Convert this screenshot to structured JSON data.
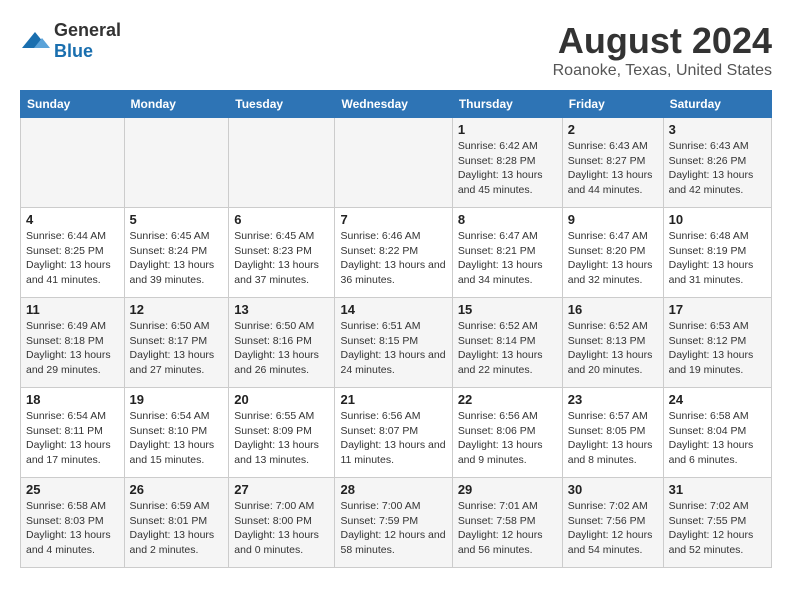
{
  "logo": {
    "text_general": "General",
    "text_blue": "Blue"
  },
  "title": "August 2024",
  "subtitle": "Roanoke, Texas, United States",
  "headers": [
    "Sunday",
    "Monday",
    "Tuesday",
    "Wednesday",
    "Thursday",
    "Friday",
    "Saturday"
  ],
  "weeks": [
    [
      {
        "day": "",
        "sunrise": "",
        "sunset": "",
        "daylight": ""
      },
      {
        "day": "",
        "sunrise": "",
        "sunset": "",
        "daylight": ""
      },
      {
        "day": "",
        "sunrise": "",
        "sunset": "",
        "daylight": ""
      },
      {
        "day": "",
        "sunrise": "",
        "sunset": "",
        "daylight": ""
      },
      {
        "day": "1",
        "sunrise": "Sunrise: 6:42 AM",
        "sunset": "Sunset: 8:28 PM",
        "daylight": "Daylight: 13 hours and 45 minutes."
      },
      {
        "day": "2",
        "sunrise": "Sunrise: 6:43 AM",
        "sunset": "Sunset: 8:27 PM",
        "daylight": "Daylight: 13 hours and 44 minutes."
      },
      {
        "day": "3",
        "sunrise": "Sunrise: 6:43 AM",
        "sunset": "Sunset: 8:26 PM",
        "daylight": "Daylight: 13 hours and 42 minutes."
      }
    ],
    [
      {
        "day": "4",
        "sunrise": "Sunrise: 6:44 AM",
        "sunset": "Sunset: 8:25 PM",
        "daylight": "Daylight: 13 hours and 41 minutes."
      },
      {
        "day": "5",
        "sunrise": "Sunrise: 6:45 AM",
        "sunset": "Sunset: 8:24 PM",
        "daylight": "Daylight: 13 hours and 39 minutes."
      },
      {
        "day": "6",
        "sunrise": "Sunrise: 6:45 AM",
        "sunset": "Sunset: 8:23 PM",
        "daylight": "Daylight: 13 hours and 37 minutes."
      },
      {
        "day": "7",
        "sunrise": "Sunrise: 6:46 AM",
        "sunset": "Sunset: 8:22 PM",
        "daylight": "Daylight: 13 hours and 36 minutes."
      },
      {
        "day": "8",
        "sunrise": "Sunrise: 6:47 AM",
        "sunset": "Sunset: 8:21 PM",
        "daylight": "Daylight: 13 hours and 34 minutes."
      },
      {
        "day": "9",
        "sunrise": "Sunrise: 6:47 AM",
        "sunset": "Sunset: 8:20 PM",
        "daylight": "Daylight: 13 hours and 32 minutes."
      },
      {
        "day": "10",
        "sunrise": "Sunrise: 6:48 AM",
        "sunset": "Sunset: 8:19 PM",
        "daylight": "Daylight: 13 hours and 31 minutes."
      }
    ],
    [
      {
        "day": "11",
        "sunrise": "Sunrise: 6:49 AM",
        "sunset": "Sunset: 8:18 PM",
        "daylight": "Daylight: 13 hours and 29 minutes."
      },
      {
        "day": "12",
        "sunrise": "Sunrise: 6:50 AM",
        "sunset": "Sunset: 8:17 PM",
        "daylight": "Daylight: 13 hours and 27 minutes."
      },
      {
        "day": "13",
        "sunrise": "Sunrise: 6:50 AM",
        "sunset": "Sunset: 8:16 PM",
        "daylight": "Daylight: 13 hours and 26 minutes."
      },
      {
        "day": "14",
        "sunrise": "Sunrise: 6:51 AM",
        "sunset": "Sunset: 8:15 PM",
        "daylight": "Daylight: 13 hours and 24 minutes."
      },
      {
        "day": "15",
        "sunrise": "Sunrise: 6:52 AM",
        "sunset": "Sunset: 8:14 PM",
        "daylight": "Daylight: 13 hours and 22 minutes."
      },
      {
        "day": "16",
        "sunrise": "Sunrise: 6:52 AM",
        "sunset": "Sunset: 8:13 PM",
        "daylight": "Daylight: 13 hours and 20 minutes."
      },
      {
        "day": "17",
        "sunrise": "Sunrise: 6:53 AM",
        "sunset": "Sunset: 8:12 PM",
        "daylight": "Daylight: 13 hours and 19 minutes."
      }
    ],
    [
      {
        "day": "18",
        "sunrise": "Sunrise: 6:54 AM",
        "sunset": "Sunset: 8:11 PM",
        "daylight": "Daylight: 13 hours and 17 minutes."
      },
      {
        "day": "19",
        "sunrise": "Sunrise: 6:54 AM",
        "sunset": "Sunset: 8:10 PM",
        "daylight": "Daylight: 13 hours and 15 minutes."
      },
      {
        "day": "20",
        "sunrise": "Sunrise: 6:55 AM",
        "sunset": "Sunset: 8:09 PM",
        "daylight": "Daylight: 13 hours and 13 minutes."
      },
      {
        "day": "21",
        "sunrise": "Sunrise: 6:56 AM",
        "sunset": "Sunset: 8:07 PM",
        "daylight": "Daylight: 13 hours and 11 minutes."
      },
      {
        "day": "22",
        "sunrise": "Sunrise: 6:56 AM",
        "sunset": "Sunset: 8:06 PM",
        "daylight": "Daylight: 13 hours and 9 minutes."
      },
      {
        "day": "23",
        "sunrise": "Sunrise: 6:57 AM",
        "sunset": "Sunset: 8:05 PM",
        "daylight": "Daylight: 13 hours and 8 minutes."
      },
      {
        "day": "24",
        "sunrise": "Sunrise: 6:58 AM",
        "sunset": "Sunset: 8:04 PM",
        "daylight": "Daylight: 13 hours and 6 minutes."
      }
    ],
    [
      {
        "day": "25",
        "sunrise": "Sunrise: 6:58 AM",
        "sunset": "Sunset: 8:03 PM",
        "daylight": "Daylight: 13 hours and 4 minutes."
      },
      {
        "day": "26",
        "sunrise": "Sunrise: 6:59 AM",
        "sunset": "Sunset: 8:01 PM",
        "daylight": "Daylight: 13 hours and 2 minutes."
      },
      {
        "day": "27",
        "sunrise": "Sunrise: 7:00 AM",
        "sunset": "Sunset: 8:00 PM",
        "daylight": "Daylight: 13 hours and 0 minutes."
      },
      {
        "day": "28",
        "sunrise": "Sunrise: 7:00 AM",
        "sunset": "Sunset: 7:59 PM",
        "daylight": "Daylight: 12 hours and 58 minutes."
      },
      {
        "day": "29",
        "sunrise": "Sunrise: 7:01 AM",
        "sunset": "Sunset: 7:58 PM",
        "daylight": "Daylight: 12 hours and 56 minutes."
      },
      {
        "day": "30",
        "sunrise": "Sunrise: 7:02 AM",
        "sunset": "Sunset: 7:56 PM",
        "daylight": "Daylight: 12 hours and 54 minutes."
      },
      {
        "day": "31",
        "sunrise": "Sunrise: 7:02 AM",
        "sunset": "Sunset: 7:55 PM",
        "daylight": "Daylight: 12 hours and 52 minutes."
      }
    ]
  ]
}
